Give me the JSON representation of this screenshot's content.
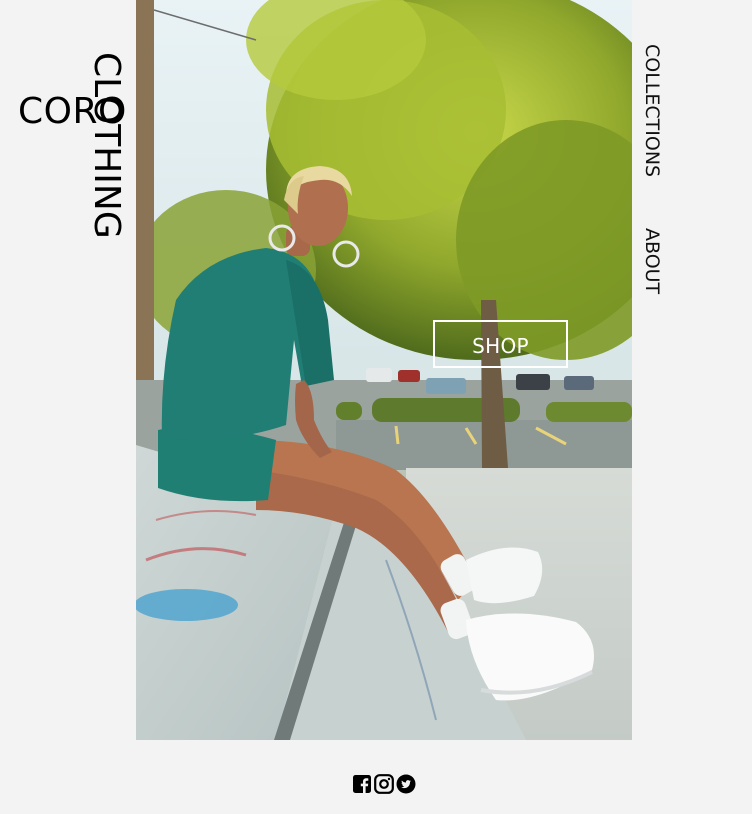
{
  "brand": {
    "word_horizontal": "CORO",
    "word_vertical": "CLOTHING"
  },
  "hero": {
    "image_icon": "fashion-photo",
    "shop_label": "SHOP"
  },
  "nav": {
    "items": [
      {
        "label": "COLLECTIONS"
      },
      {
        "label": "ABOUT"
      }
    ]
  },
  "social": {
    "icons": [
      "facebook-icon",
      "instagram-icon",
      "twitter-icon"
    ]
  },
  "colors": {
    "page_background": "#f3f3f3",
    "text": "#000000",
    "shop_border": "#ffffff"
  }
}
